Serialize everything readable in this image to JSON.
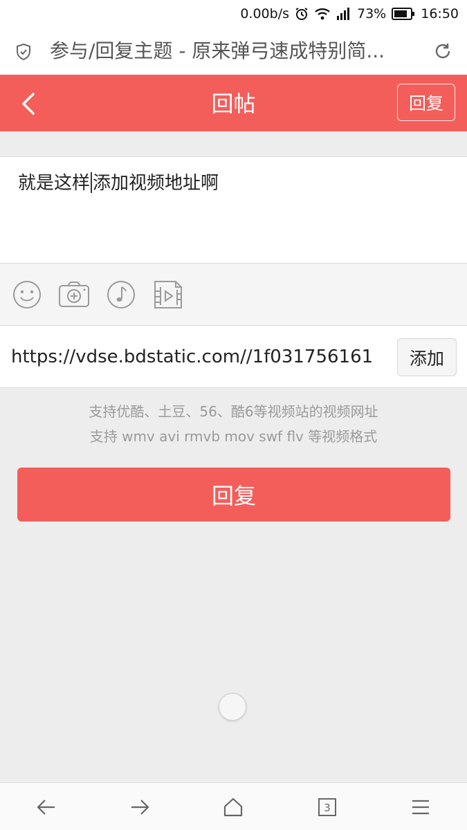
{
  "status_bar": {
    "net_speed": "0.00b/s",
    "battery": "73%",
    "time": "16:50",
    "icons": [
      "alarm-icon",
      "wifi-icon",
      "signal-icon",
      "battery-icon"
    ]
  },
  "browser": {
    "page_title": "参与/回复主题 - 原来弹弓速成特别简...",
    "icons": [
      "shield-icon",
      "reload-icon"
    ]
  },
  "header": {
    "title": "回帖",
    "reply_button": "回复",
    "color": "#f35e5a"
  },
  "editor": {
    "text_before_caret": "就是这样",
    "text_after_caret": "添加视频地址啊"
  },
  "toolbar": {
    "tools": [
      "emoji-icon",
      "camera-icon",
      "music-icon",
      "video-icon"
    ]
  },
  "video_url": {
    "value": "https://vdse.bdstatic.com//1f031756161",
    "add_button": "添加"
  },
  "hints": {
    "line1": "支持优酷、土豆、56、酷6等视频站的视频网址",
    "line2": "支持 wmv avi rmvb mov swf flv 等视频格式"
  },
  "submit_button": "回复",
  "bottom_nav": {
    "tab_count": "3",
    "icons": [
      "back-arrow-icon",
      "forward-arrow-icon",
      "home-icon",
      "tabs-icon",
      "menu-icon"
    ]
  }
}
